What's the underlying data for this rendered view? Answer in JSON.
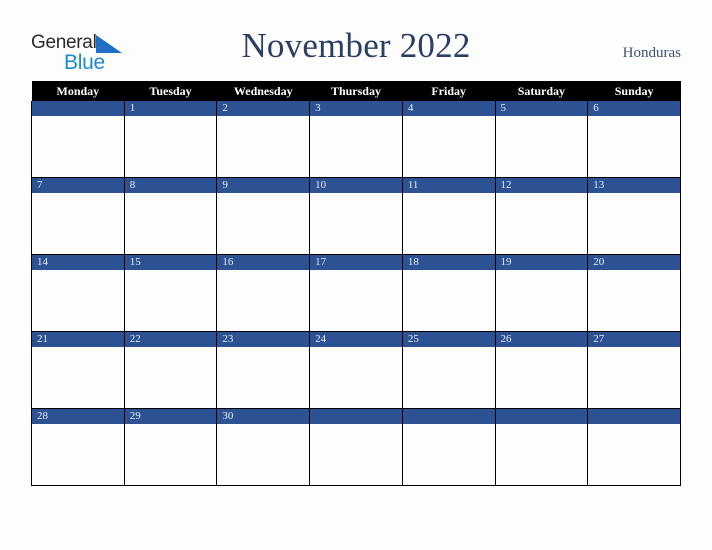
{
  "brand": {
    "name_part1": "General",
    "name_part2": "Blue",
    "triangle_icon": "blue-triangle-icon",
    "part1_color": "#2b2b2b",
    "part2_color": "#1b8ad4",
    "triangle_color": "#1f6fc4"
  },
  "header": {
    "title": "November 2022",
    "country": "Honduras",
    "title_color": "#2b3f63",
    "country_color": "#3c4f73"
  },
  "calendar": {
    "month": "November",
    "year": "2022",
    "header_bg": "#000000",
    "header_text_color": "#ffffff",
    "day_band_color": "#2d5293",
    "day_number_color": "#e8edf5",
    "cell_bg": "#fdfdfd",
    "grid_line_color": "#000000",
    "weekday_headers": [
      "Monday",
      "Tuesday",
      "Wednesday",
      "Thursday",
      "Friday",
      "Saturday",
      "Sunday"
    ],
    "weeks": [
      [
        "",
        "1",
        "2",
        "3",
        "4",
        "5",
        "6"
      ],
      [
        "7",
        "8",
        "9",
        "10",
        "11",
        "12",
        "13"
      ],
      [
        "14",
        "15",
        "16",
        "17",
        "18",
        "19",
        "20"
      ],
      [
        "21",
        "22",
        "23",
        "24",
        "25",
        "26",
        "27"
      ],
      [
        "28",
        "29",
        "30",
        "",
        "",
        "",
        ""
      ]
    ]
  }
}
